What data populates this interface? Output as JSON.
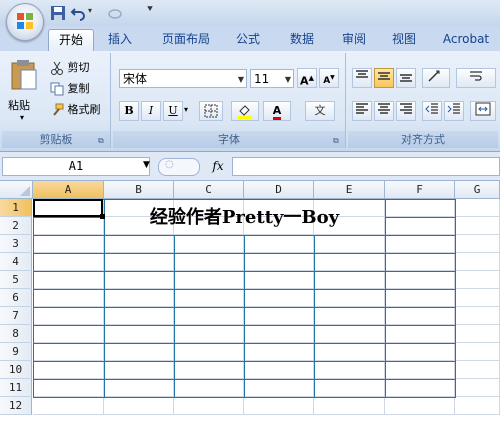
{
  "tabs": [
    "开始",
    "插入",
    "页面布局",
    "公式",
    "数据",
    "审阅",
    "视图",
    "Acrobat"
  ],
  "clipboard": {
    "paste": "粘贴",
    "cut": "剪切",
    "copy": "复制",
    "format_painter": "格式刷",
    "group_label": "剪贴板"
  },
  "font": {
    "name": "宋体",
    "size": "11",
    "group_label": "字体",
    "grow": "A",
    "shrink": "A",
    "bold": "B",
    "italic": "I",
    "underline": "U",
    "font_color": "A",
    "wen": "文"
  },
  "alignment": {
    "group_label": "对齐方式"
  },
  "formula_bar": {
    "name_box": "A1",
    "fx": "fx",
    "value": ""
  },
  "sheet": {
    "columns": [
      "A",
      "B",
      "C",
      "D",
      "E",
      "F",
      "G"
    ],
    "rows": [
      "1",
      "2",
      "3",
      "4",
      "5",
      "6",
      "7",
      "8",
      "9",
      "10",
      "11",
      "12"
    ],
    "selected_cell": "A1",
    "merged_text": "经验作者Pretty一Boy"
  },
  "colors": {
    "accent": "#15428b",
    "table_border": "#1f75a8",
    "selected_header": "#f1c15f"
  }
}
